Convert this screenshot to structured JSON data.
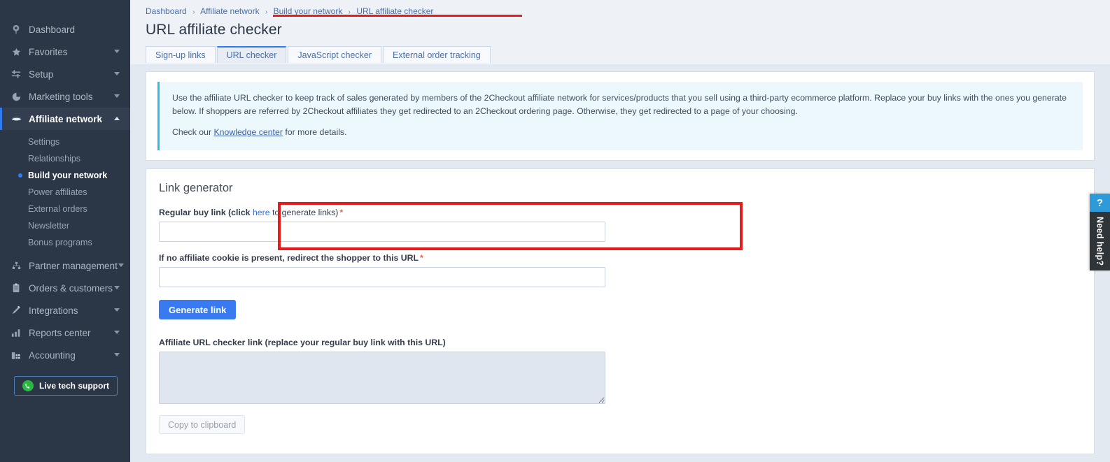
{
  "sidebar": {
    "items": [
      {
        "label": "Dashboard",
        "icon": "dashboard-icon",
        "has_caret": false
      },
      {
        "label": "Favorites",
        "icon": "star-icon",
        "has_caret": true
      },
      {
        "label": "Setup",
        "icon": "sliders-icon",
        "has_caret": true
      },
      {
        "label": "Marketing tools",
        "icon": "pie-chart-icon",
        "has_caret": true
      },
      {
        "label": "Affiliate network",
        "icon": "handshake-icon",
        "has_caret": true,
        "active": true,
        "expanded": true
      },
      {
        "label": "Partner management",
        "icon": "org-chart-icon",
        "has_caret": true
      },
      {
        "label": "Orders & customers",
        "icon": "clipboard-icon",
        "has_caret": true
      },
      {
        "label": "Integrations",
        "icon": "plug-icon",
        "has_caret": true
      },
      {
        "label": "Reports center",
        "icon": "bar-chart-icon",
        "has_caret": true
      },
      {
        "label": "Accounting",
        "icon": "ledger-icon",
        "has_caret": true
      }
    ],
    "sub_items": [
      {
        "label": "Settings",
        "current": false
      },
      {
        "label": "Relationships",
        "current": false
      },
      {
        "label": "Build your network",
        "current": true
      },
      {
        "label": "Power affiliates",
        "current": false
      },
      {
        "label": "External orders",
        "current": false
      },
      {
        "label": "Newsletter",
        "current": false
      },
      {
        "label": "Bonus programs",
        "current": false
      }
    ],
    "support_button": {
      "label": "Live tech support",
      "icon": "phone-support-icon"
    },
    "colors": {
      "background": "#2b3647",
      "active_bar": "#2f7bf6",
      "support_green": "#2cb742"
    }
  },
  "breadcrumb": {
    "items": [
      "Dashboard",
      "Affiliate network",
      "Build your network",
      "URL affiliate checker"
    ],
    "separator": "›"
  },
  "header": {
    "title": "URL affiliate checker"
  },
  "tabs": [
    {
      "label": "Sign-up links",
      "active": false
    },
    {
      "label": "URL checker",
      "active": true
    },
    {
      "label": "JavaScript checker",
      "active": false
    },
    {
      "label": "External order tracking",
      "active": false
    }
  ],
  "info": {
    "paragraph": "Use the affiliate URL checker to keep track of sales generated by members of the 2Checkout affiliate network for services/products that you sell using a third-party ecommerce platform. Replace your buy links with the ones you generate below. If shoppers are referred by 2Checkout affiliates they get redirected to an 2Checkout ordering page. Otherwise, they get redirected to a page of your choosing.",
    "check_prefix": "Check our ",
    "link": "Knowledge center",
    "check_suffix": " for more details.",
    "accent_color": "#2dbbe8"
  },
  "form": {
    "section_title": "Link generator",
    "buy_link": {
      "label_prefix": "Regular buy link (click ",
      "label_link": "here",
      "label_suffix": " to generate links)",
      "required_mark": "*",
      "value": "",
      "placeholder": ""
    },
    "redirect": {
      "label": "If no affiliate cookie is present, redirect the shopper to this URL",
      "required_mark": "*",
      "value": "",
      "placeholder": ""
    },
    "generate_button": "Generate link",
    "result": {
      "label": "Affiliate URL checker link (replace your regular buy link with this URL)",
      "value": "",
      "placeholder": ""
    },
    "copy_button": "Copy to clipboard",
    "primary_color": "#3a7af0"
  },
  "need_help": {
    "question_mark": "?",
    "label": "Need help?",
    "accent": "#2d9ada"
  },
  "annotations": {
    "color": "#e81a1a"
  }
}
